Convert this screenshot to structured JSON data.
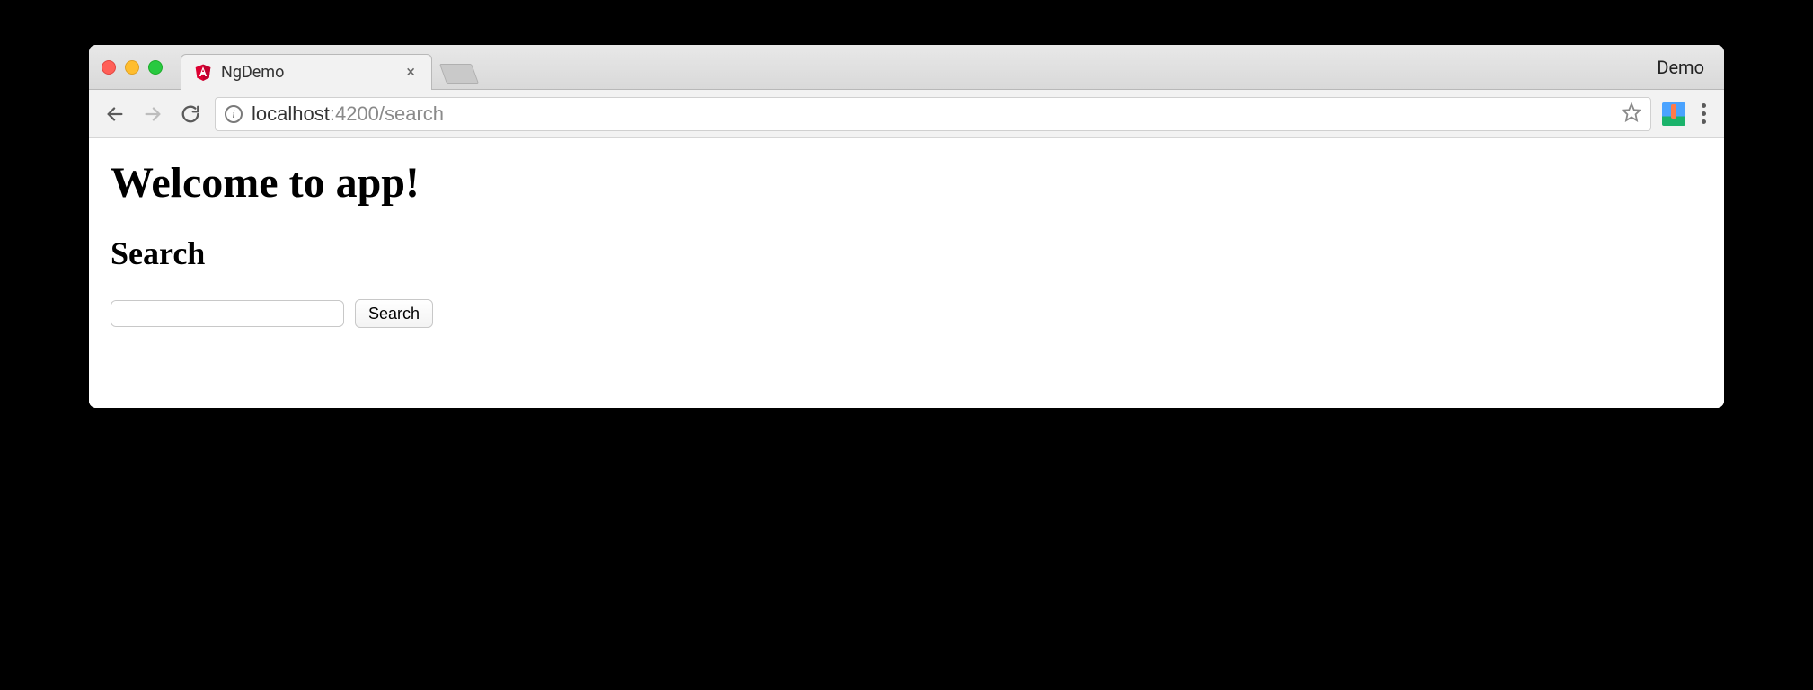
{
  "browser": {
    "tab_title": "NgDemo",
    "window_label": "Demo",
    "url_host": "localhost",
    "url_port_path": ":4200/search"
  },
  "page": {
    "heading": "Welcome to app!",
    "subheading": "Search",
    "search_input_value": "",
    "search_button_label": "Search"
  }
}
